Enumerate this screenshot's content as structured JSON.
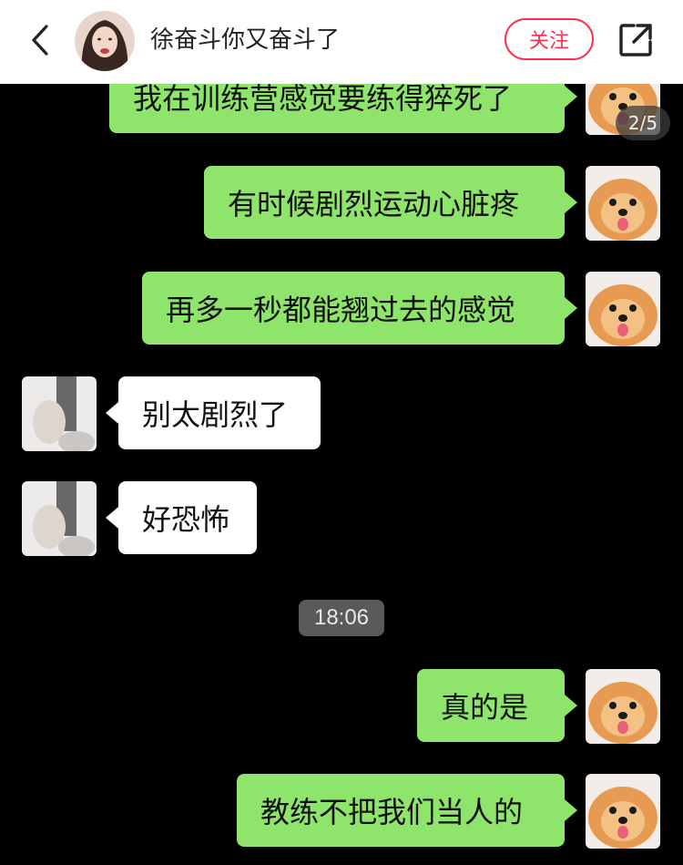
{
  "header": {
    "author_name": "徐奋斗你又奋斗了",
    "follow_label": "关注"
  },
  "gallery": {
    "page_indicator": "2/5"
  },
  "chat": {
    "messages": [
      {
        "sender": "me",
        "text": "我在训练营感觉要练得猝死了"
      },
      {
        "sender": "me",
        "text": "有时候剧烈运动心脏疼"
      },
      {
        "sender": "me",
        "text": "再多一秒都能翘过去的感觉"
      },
      {
        "sender": "friend",
        "text": "别太剧烈了"
      },
      {
        "sender": "friend",
        "text": "好恐怖"
      },
      {
        "sender": "me",
        "text": "真的是"
      },
      {
        "sender": "me",
        "text": "教练不把我们当人的"
      }
    ],
    "timestamp": "18:06"
  },
  "colors": {
    "my_bubble": "#8fe46c",
    "friend_bubble": "#ffffff",
    "follow_accent": "#ff2e4d",
    "background": "#000000"
  },
  "icons": {
    "back": "chevron-left-icon",
    "share": "share-icon"
  }
}
